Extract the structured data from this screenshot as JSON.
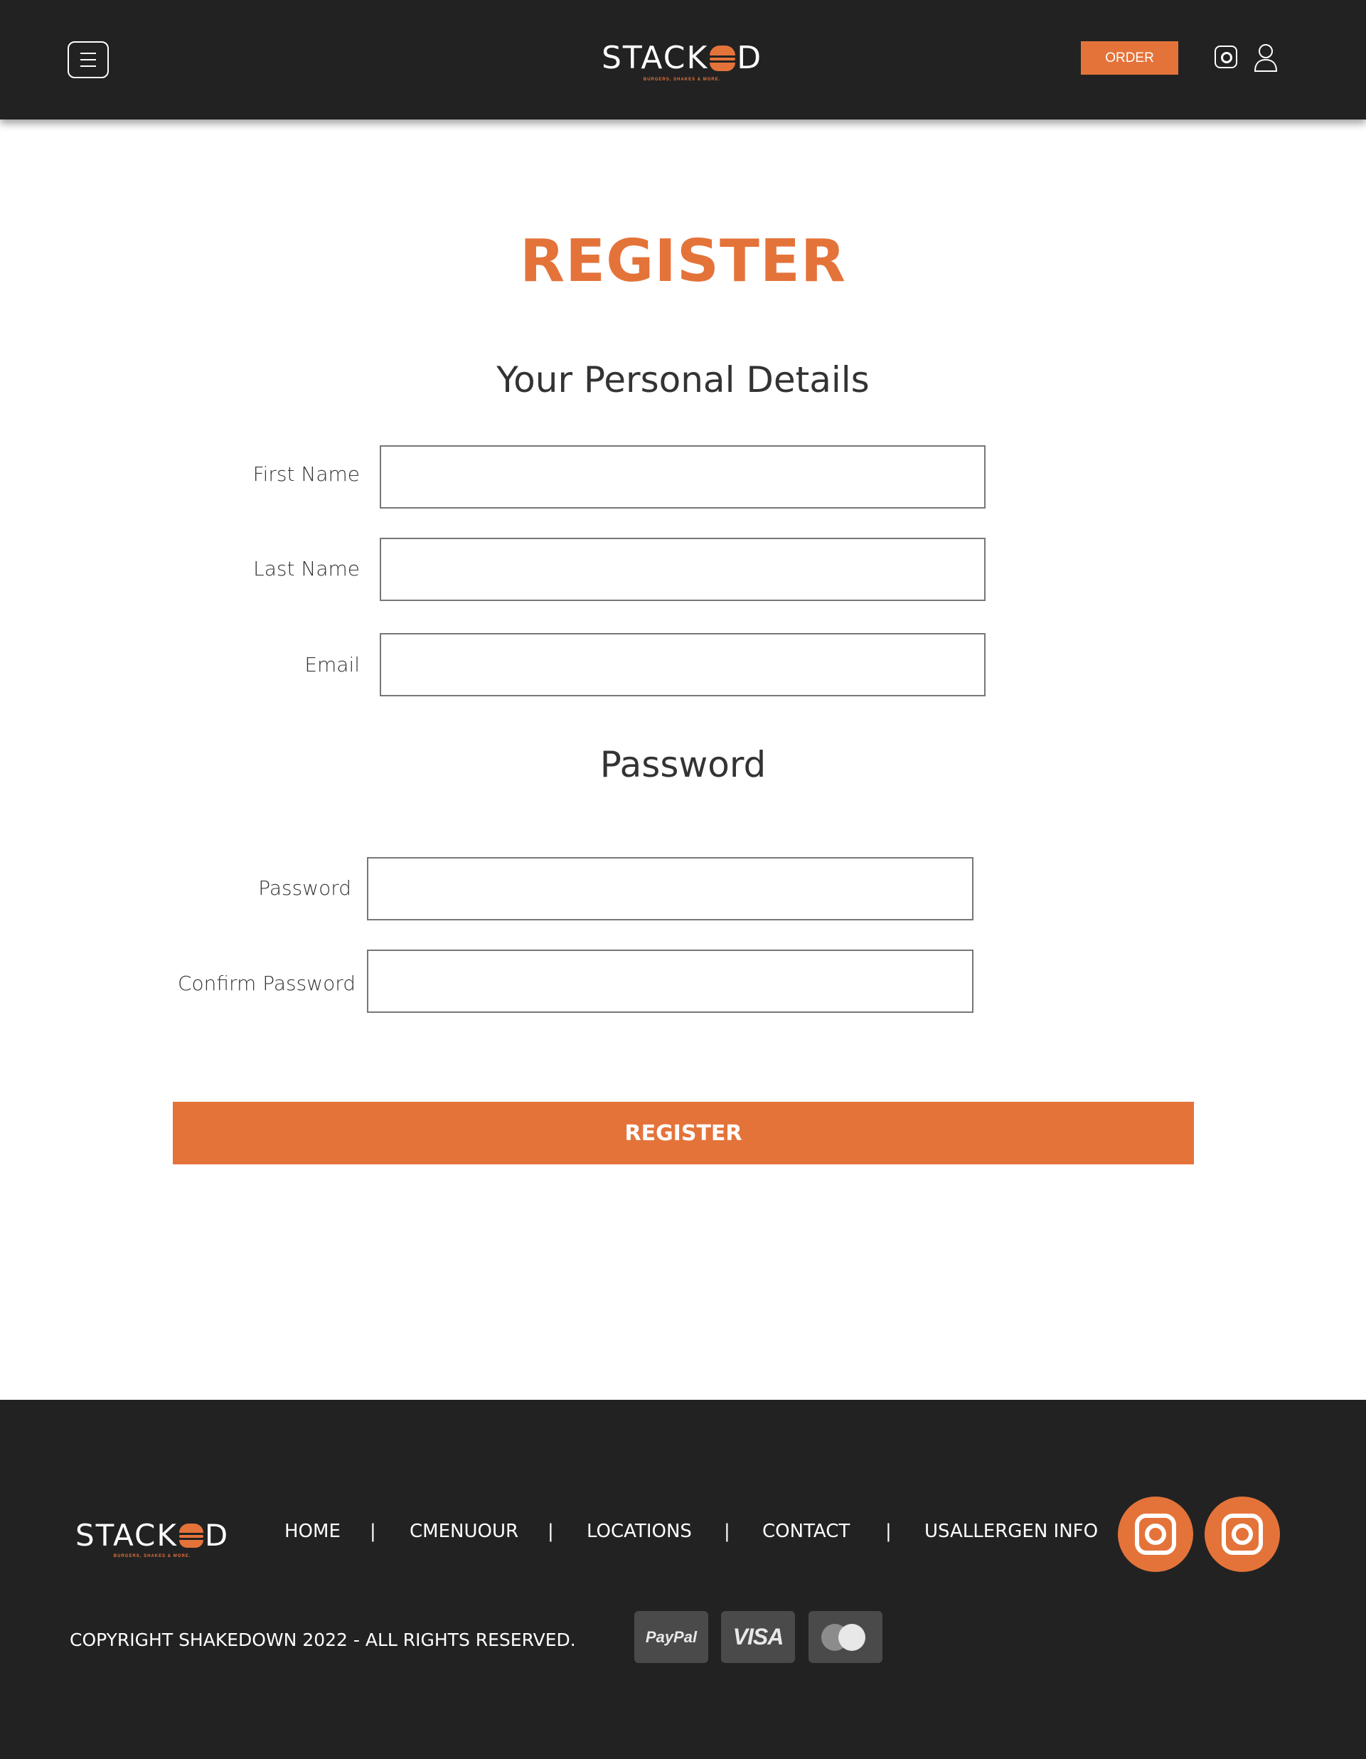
{
  "header": {
    "brand": {
      "name_left": "STACK",
      "name_right": "D",
      "tagline": "BURGERS, SHAKES & MORE."
    },
    "order_label": "ORDER"
  },
  "main": {
    "title": "REGISTER",
    "personal_heading": "Your Personal Details",
    "fields": {
      "first_name": {
        "label": "First Name",
        "value": "",
        "placeholder": ""
      },
      "last_name": {
        "label": "Last Name",
        "value": "",
        "placeholder": ""
      },
      "email": {
        "label": "Email",
        "value": "",
        "placeholder": ""
      },
      "password": {
        "label": "Password",
        "value": "",
        "placeholder": ""
      },
      "confirm_password": {
        "label": "Confirm Password",
        "value": "",
        "placeholder": ""
      }
    },
    "password_heading": "Password",
    "register_label": "REGISTER"
  },
  "footer": {
    "brand": {
      "name_left": "STACK",
      "name_right": "D",
      "tagline": "BURGERS, SHAKES & MORE."
    },
    "nav": [
      {
        "label": "HOME"
      },
      {
        "label": "CMENUOUR"
      },
      {
        "label": "LOCATIONS"
      },
      {
        "label": "CONTACT"
      },
      {
        "label": "USALLERGEN INFO"
      }
    ],
    "separator": "|",
    "copyright": "COPYRIGHT SHAKEDOWN 2022 - ALL RIGHTS RESERVED.",
    "payments": [
      "PayPal",
      "VISA",
      "Mastercard"
    ]
  },
  "colors": {
    "accent": "#e4733a",
    "dark": "#222222",
    "text": "#333333",
    "card": "#4a4a4a"
  },
  "icons": [
    "menu-icon",
    "burger-logo-icon",
    "instagram-icon",
    "user-icon",
    "paypal-icon",
    "visa-icon",
    "mastercard-icon"
  ]
}
